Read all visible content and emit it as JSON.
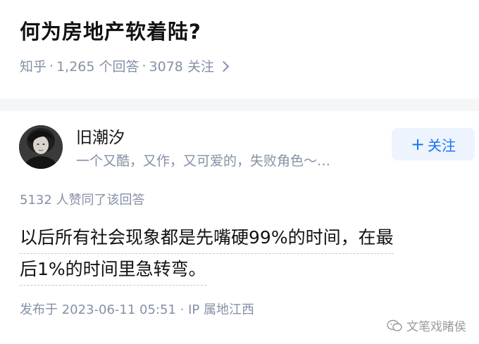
{
  "question": {
    "title": "何为房地产软着陆?",
    "source": "知乎",
    "answers_count": "1,265 个回答",
    "followers_count": "3078 关注",
    "separator": "·"
  },
  "answer": {
    "author": {
      "name": "旧潮汐",
      "bio": "一个又酷，又作，又可爱的，失败角色～…"
    },
    "follow_button": {
      "plus": "+",
      "label": "关注"
    },
    "vote_text": "5132 人赞同了该回答",
    "content_lines": [
      "以后所有社会现象都是先嘴硬99%的时间，在最",
      "后1%的时间里急转弯。"
    ],
    "publish_info": "发布于 2023-06-11 05:51 · IP 属地江西"
  },
  "watermark": {
    "text": "文笔戏睹侯"
  },
  "colors": {
    "accent": "#1772f6",
    "meta_gray": "#8590a6",
    "divider_bg": "#f5f6f7"
  }
}
